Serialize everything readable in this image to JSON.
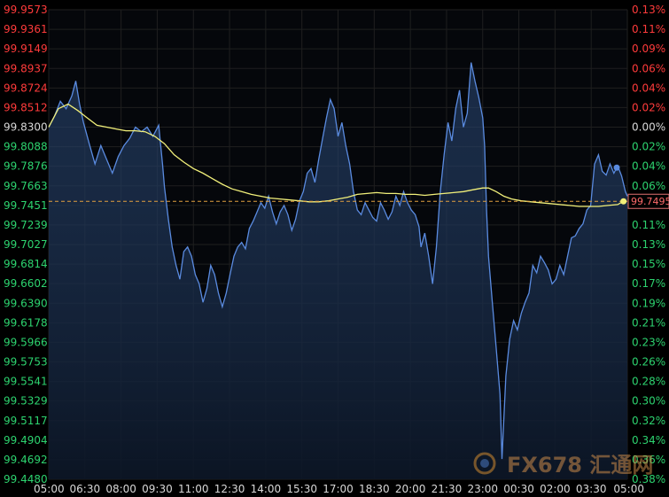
{
  "chart_data": {
    "type": "area",
    "title": "",
    "xlabel": "",
    "ylabel": "",
    "x_ticks": [
      "05:00",
      "06:30",
      "08:00",
      "09:30",
      "11:00",
      "12:30",
      "14:00",
      "15:30",
      "17:00",
      "18:30",
      "20:00",
      "21:30",
      "23:00",
      "00:30",
      "02:00",
      "03:30",
      "05:00"
    ],
    "left_ticks": [
      "99.9573",
      "99.9361",
      "99.9149",
      "99.8937",
      "99.8724",
      "99.8512",
      "99.8300",
      "99.8088",
      "99.7876",
      "99.7663",
      "99.7451",
      "99.7239",
      "99.7027",
      "99.6814",
      "99.6602",
      "99.6390",
      "99.6178",
      "99.5966",
      "99.5753",
      "99.5541",
      "99.5329",
      "99.5117",
      "99.4904",
      "99.4692",
      "99.4480"
    ],
    "right_ticks": [
      "0.13%",
      "0.11%",
      "0.09%",
      "0.06%",
      "0.04%",
      "0.02%",
      "0.00%",
      "0.02%",
      "0.04%",
      "0.06%",
      "0.09%",
      "0.11%",
      "0.13%",
      "0.15%",
      "0.17%",
      "0.19%",
      "0.21%",
      "0.23%",
      "0.26%",
      "0.28%",
      "0.30%",
      "0.32%",
      "0.34%",
      "0.36%",
      "0.38%"
    ],
    "ylim": [
      99.448,
      99.9573
    ],
    "reference_value": 99.83,
    "last_price_label": "99.7495",
    "last_price": 99.7495,
    "series": [
      {
        "kind": "price",
        "points": [
          [
            0,
            99.83
          ],
          [
            3,
            99.842
          ],
          [
            6,
            99.858
          ],
          [
            9,
            99.85
          ],
          [
            12,
            99.864
          ],
          [
            14,
            99.88
          ],
          [
            16,
            99.855
          ],
          [
            18,
            99.835
          ],
          [
            21,
            99.812
          ],
          [
            24,
            99.79
          ],
          [
            27,
            99.81
          ],
          [
            30,
            99.795
          ],
          [
            33,
            99.78
          ],
          [
            36,
            99.798
          ],
          [
            39,
            99.81
          ],
          [
            42,
            99.818
          ],
          [
            45,
            99.83
          ],
          [
            48,
            99.825
          ],
          [
            51,
            99.83
          ],
          [
            54,
            99.82
          ],
          [
            57,
            99.832
          ],
          [
            59,
            99.79
          ],
          [
            60,
            99.765
          ],
          [
            62,
            99.73
          ],
          [
            64,
            99.7
          ],
          [
            66,
            99.68
          ],
          [
            68,
            99.665
          ],
          [
            70,
            99.695
          ],
          [
            72,
            99.7
          ],
          [
            74,
            99.69
          ],
          [
            76,
            99.67
          ],
          [
            78,
            99.66
          ],
          [
            80,
            99.64
          ],
          [
            82,
            99.655
          ],
          [
            84,
            99.68
          ],
          [
            86,
            99.67
          ],
          [
            88,
            99.65
          ],
          [
            90,
            99.635
          ],
          [
            92,
            99.65
          ],
          [
            94,
            99.67
          ],
          [
            96,
            99.69
          ],
          [
            98,
            99.7
          ],
          [
            100,
            99.705
          ],
          [
            102,
            99.698
          ],
          [
            104,
            99.72
          ],
          [
            106,
            99.728
          ],
          [
            108,
            99.738
          ],
          [
            110,
            99.748
          ],
          [
            112,
            99.742
          ],
          [
            114,
            99.755
          ],
          [
            116,
            99.738
          ],
          [
            118,
            99.725
          ],
          [
            120,
            99.738
          ],
          [
            122,
            99.745
          ],
          [
            124,
            99.735
          ],
          [
            126,
            99.718
          ],
          [
            128,
            99.73
          ],
          [
            130,
            99.75
          ],
          [
            132,
            99.76
          ],
          [
            134,
            99.78
          ],
          [
            136,
            99.785
          ],
          [
            138,
            99.77
          ],
          [
            140,
            99.795
          ],
          [
            142,
            99.818
          ],
          [
            144,
            99.84
          ],
          [
            146,
            99.86
          ],
          [
            148,
            99.85
          ],
          [
            150,
            99.82
          ],
          [
            152,
            99.835
          ],
          [
            154,
            99.81
          ],
          [
            156,
            99.79
          ],
          [
            158,
            99.76
          ],
          [
            160,
            99.74
          ],
          [
            162,
            99.735
          ],
          [
            164,
            99.748
          ],
          [
            166,
            99.74
          ],
          [
            168,
            99.732
          ],
          [
            170,
            99.728
          ],
          [
            172,
            99.748
          ],
          [
            174,
            99.74
          ],
          [
            176,
            99.73
          ],
          [
            178,
            99.738
          ],
          [
            180,
            99.755
          ],
          [
            182,
            99.745
          ],
          [
            184,
            99.76
          ],
          [
            186,
            99.748
          ],
          [
            188,
            99.74
          ],
          [
            190,
            99.735
          ],
          [
            192,
            99.722
          ],
          [
            193,
            99.7
          ],
          [
            195,
            99.715
          ],
          [
            197,
            99.69
          ],
          [
            199,
            99.66
          ],
          [
            201,
            99.7
          ],
          [
            203,
            99.76
          ],
          [
            205,
            99.8
          ],
          [
            207,
            99.835
          ],
          [
            209,
            99.815
          ],
          [
            211,
            99.85
          ],
          [
            213,
            99.87
          ],
          [
            215,
            99.83
          ],
          [
            217,
            99.845
          ],
          [
            219,
            99.9
          ],
          [
            221,
            99.88
          ],
          [
            223,
            99.862
          ],
          [
            225,
            99.84
          ],
          [
            226,
            99.81
          ],
          [
            227,
            99.74
          ],
          [
            228,
            99.69
          ],
          [
            230,
            99.64
          ],
          [
            232,
            99.59
          ],
          [
            234,
            99.54
          ],
          [
            235,
            99.47
          ],
          [
            237,
            99.56
          ],
          [
            239,
            99.6
          ],
          [
            241,
            99.62
          ],
          [
            243,
            99.61
          ],
          [
            245,
            99.628
          ],
          [
            247,
            99.64
          ],
          [
            249,
            99.65
          ],
          [
            251,
            99.68
          ],
          [
            253,
            99.672
          ],
          [
            255,
            99.69
          ],
          [
            257,
            99.683
          ],
          [
            259,
            99.675
          ],
          [
            261,
            99.66
          ],
          [
            263,
            99.665
          ],
          [
            265,
            99.68
          ],
          [
            267,
            99.67
          ],
          [
            269,
            99.69
          ],
          [
            271,
            99.71
          ],
          [
            273,
            99.712
          ],
          [
            275,
            99.72
          ],
          [
            277,
            99.725
          ],
          [
            279,
            99.74
          ],
          [
            281,
            99.745
          ],
          [
            283,
            99.79
          ],
          [
            285,
            99.8
          ],
          [
            287,
            99.782
          ],
          [
            289,
            99.778
          ],
          [
            291,
            99.79
          ],
          [
            293,
            99.78
          ],
          [
            295,
            99.788
          ],
          [
            297,
            99.777
          ],
          [
            299,
            99.76
          ],
          [
            300,
            99.755
          ]
        ]
      },
      {
        "kind": "average",
        "points": [
          [
            0,
            99.83
          ],
          [
            5,
            99.85
          ],
          [
            10,
            99.855
          ],
          [
            15,
            99.848
          ],
          [
            20,
            99.84
          ],
          [
            25,
            99.832
          ],
          [
            30,
            99.83
          ],
          [
            35,
            99.828
          ],
          [
            40,
            99.826
          ],
          [
            45,
            99.826
          ],
          [
            50,
            99.825
          ],
          [
            55,
            99.82
          ],
          [
            60,
            99.812
          ],
          [
            65,
            99.8
          ],
          [
            70,
            99.792
          ],
          [
            75,
            99.785
          ],
          [
            80,
            99.78
          ],
          [
            85,
            99.774
          ],
          [
            90,
            99.768
          ],
          [
            95,
            99.763
          ],
          [
            100,
            99.76
          ],
          [
            105,
            99.757
          ],
          [
            110,
            99.755
          ],
          [
            115,
            99.753
          ],
          [
            120,
            99.752
          ],
          [
            125,
            99.751
          ],
          [
            130,
            99.75
          ],
          [
            135,
            99.749
          ],
          [
            140,
            99.749
          ],
          [
            145,
            99.75
          ],
          [
            150,
            99.752
          ],
          [
            155,
            99.754
          ],
          [
            160,
            99.757
          ],
          [
            165,
            99.758
          ],
          [
            170,
            99.759
          ],
          [
            175,
            99.758
          ],
          [
            180,
            99.758
          ],
          [
            185,
            99.757
          ],
          [
            190,
            99.757
          ],
          [
            195,
            99.756
          ],
          [
            200,
            99.757
          ],
          [
            205,
            99.758
          ],
          [
            210,
            99.759
          ],
          [
            215,
            99.76
          ],
          [
            220,
            99.762
          ],
          [
            225,
            99.764
          ],
          [
            228,
            99.764
          ],
          [
            232,
            99.76
          ],
          [
            236,
            99.755
          ],
          [
            240,
            99.752
          ],
          [
            245,
            99.75
          ],
          [
            250,
            99.749
          ],
          [
            255,
            99.748
          ],
          [
            260,
            99.747
          ],
          [
            265,
            99.746
          ],
          [
            270,
            99.745
          ],
          [
            275,
            99.744
          ],
          [
            280,
            99.744
          ],
          [
            285,
            99.744
          ],
          [
            290,
            99.745
          ],
          [
            295,
            99.746
          ],
          [
            298,
            99.7495
          ]
        ]
      }
    ]
  },
  "colors": {
    "background": "#000000",
    "price_line": "#5a8be0",
    "average_line": "#f2f07a",
    "reference_line": "#e0a040",
    "positive_tick": "#ff3b3b",
    "negative_tick": "#2dd36f",
    "neutral_tick": "#d8d8d8"
  },
  "watermark": {
    "text": "FX678 汇通网"
  }
}
